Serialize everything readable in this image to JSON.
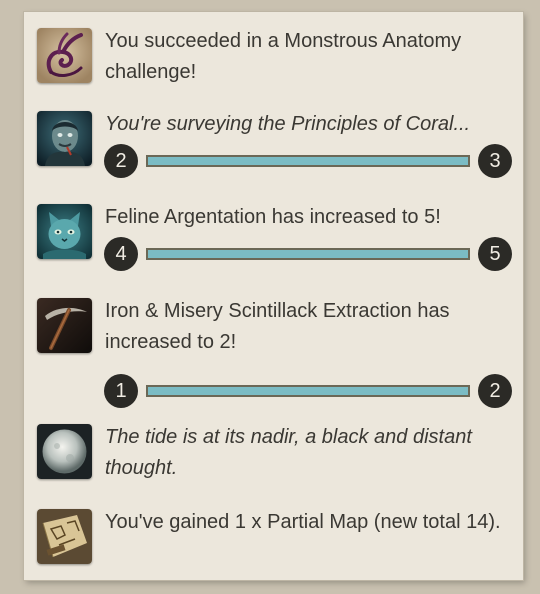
{
  "colors": {
    "panel_background": "#ece7dc",
    "text": "#3a3833",
    "progress_fill": "#7bbcc4",
    "progress_border": "#6b6856",
    "number_circle": "#2b2a26"
  },
  "messages": [
    {
      "icon": "monstrous-anatomy-glyph-icon",
      "text": "You succeeded in a Monstrous Anatomy challenge!"
    },
    {
      "icon": "zailor-portrait-icon",
      "text": "You're surveying the Principles of Coral...",
      "progress": {
        "from": "2",
        "to": "3",
        "fill_fraction": 1.0
      }
    },
    {
      "icon": "feline-creature-icon",
      "text": "Feline Argentation has increased to 5!",
      "progress": {
        "from": "4",
        "to": "5",
        "fill_fraction": 1.0
      }
    },
    {
      "icon": "pickaxe-icon",
      "text": "Iron & Misery Scintillack Extraction has increased to 2!",
      "progress": {
        "from": "1",
        "to": "2",
        "fill_fraction": 1.0
      }
    },
    {
      "icon": "pale-moon-icon",
      "text": "The tide is at its nadir, a black and distant thought."
    },
    {
      "icon": "partial-map-icon",
      "text": "You've gained 1 x Partial Map (new total 14)."
    }
  ]
}
